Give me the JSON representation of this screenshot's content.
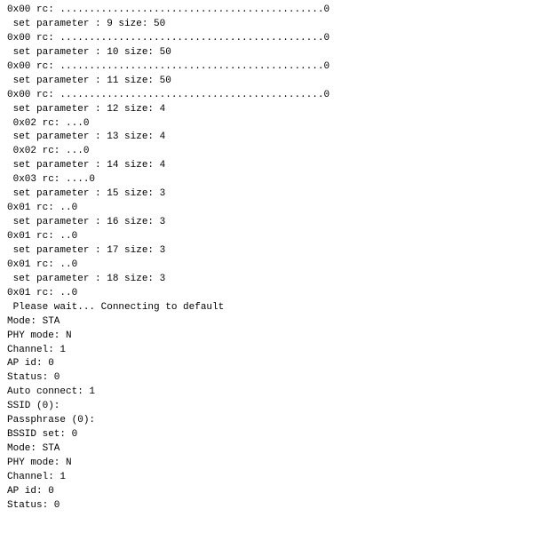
{
  "terminal": {
    "lines": [
      {
        "text": "0x00 rc: .............................................0",
        "indent": false
      },
      {
        "text": " set parameter : 9 size: 50",
        "indent": false
      },
      {
        "text": "0x00 rc: .............................................0",
        "indent": false
      },
      {
        "text": " set parameter : 10 size: 50",
        "indent": false
      },
      {
        "text": "0x00 rc: .............................................0",
        "indent": false
      },
      {
        "text": " set parameter : 11 size: 50",
        "indent": false
      },
      {
        "text": "0x00 rc: .............................................0",
        "indent": false
      },
      {
        "text": " set parameter : 12 size: 4",
        "indent": false
      },
      {
        "text": " 0x02 rc: ...0",
        "indent": false
      },
      {
        "text": " set parameter : 13 size: 4",
        "indent": false
      },
      {
        "text": " 0x02 rc: ...0",
        "indent": false
      },
      {
        "text": " set parameter : 14 size: 4",
        "indent": false
      },
      {
        "text": " 0x03 rc: ....0",
        "indent": false
      },
      {
        "text": " set parameter : 15 size: 3",
        "indent": false
      },
      {
        "text": "0x01 rc: ..0",
        "indent": false
      },
      {
        "text": " set parameter : 16 size: 3",
        "indent": false
      },
      {
        "text": "0x01 rc: ..0",
        "indent": false
      },
      {
        "text": " set parameter : 17 size: 3",
        "indent": false
      },
      {
        "text": "0x01 rc: ..0",
        "indent": false
      },
      {
        "text": " set parameter : 18 size: 3",
        "indent": false
      },
      {
        "text": "0x01 rc: ..0",
        "indent": false
      },
      {
        "text": "",
        "indent": false
      },
      {
        "text": " Please wait... Connecting to default",
        "indent": false
      },
      {
        "text": "Mode: STA",
        "indent": false
      },
      {
        "text": "PHY mode: N",
        "indent": false
      },
      {
        "text": "Channel: 1",
        "indent": false
      },
      {
        "text": "AP id: 0",
        "indent": false
      },
      {
        "text": "Status: 0",
        "indent": false
      },
      {
        "text": "Auto connect: 1",
        "indent": false
      },
      {
        "text": "SSID (0):",
        "indent": false
      },
      {
        "text": "Passphrase (0):",
        "indent": false
      },
      {
        "text": "BSSID set: 0",
        "indent": false
      },
      {
        "text": "Mode: STA",
        "indent": false
      },
      {
        "text": "PHY mode: N",
        "indent": false
      },
      {
        "text": "Channel: 1",
        "indent": false
      },
      {
        "text": "AP id: 0",
        "indent": false
      },
      {
        "text": "Status: 0",
        "indent": false
      }
    ]
  }
}
